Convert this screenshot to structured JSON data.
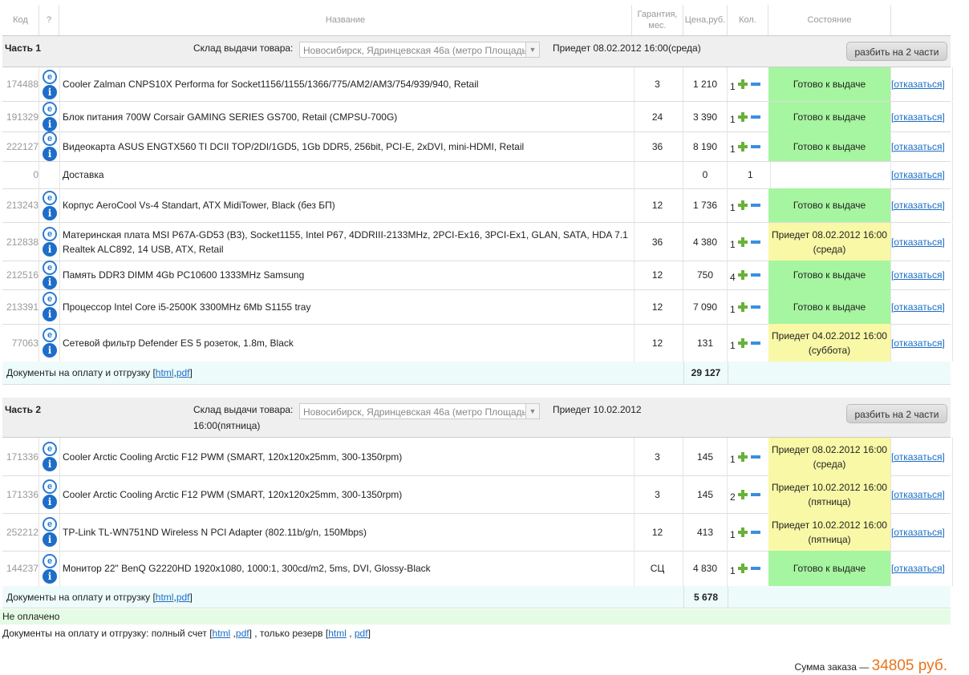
{
  "header": {
    "code": "Код",
    "q": "?",
    "name": "Название",
    "warranty": "Гарантия, мес.",
    "price": "Цена,руб.",
    "qty": "Кол.",
    "state": "Состояние"
  },
  "cancel_label": "[отказаться]",
  "part1": {
    "title": "Часть 1",
    "warehouse_label": "Склад выдачи товара:",
    "warehouse_value": "Новосибирск, Ядринцевская 46а (метро Площадь",
    "arrive": "Приедет 08.02.2012 16:00(среда)",
    "split_label": "разбить на 2 части",
    "rows": [
      {
        "code": "174488",
        "name": "Cooler Zalman CNPS10X Performa for Socket1156/1155/1366/775/AM2/AM3/754/939/940, Retail",
        "warranty": "3",
        "price": "1 210",
        "qty": "1",
        "state": "Готово к выдаче",
        "state_kind": "green"
      },
      {
        "code": "191329",
        "name": "Блок питания 700W Corsair GAMING SERIES GS700, Retail (CMPSU-700G)",
        "warranty": "24",
        "price": "3 390",
        "qty": "1",
        "state": "Готово к выдаче",
        "state_kind": "green"
      },
      {
        "code": "222127",
        "name": "Видеокарта ASUS ENGTX560 TI DCII TOP/2DI/1GD5, 1Gb DDR5, 256bit, PCI-E, 2xDVI, mini-HDMI, Retail",
        "warranty": "36",
        "price": "8 190",
        "qty": "1",
        "state": "Готово к выдаче",
        "state_kind": "green"
      },
      {
        "code": "0",
        "name": "Доставка",
        "warranty": "",
        "price": "0",
        "qty": "1",
        "state": "",
        "state_kind": "none"
      },
      {
        "code": "213243",
        "name": "Корпус AeroCool Vs-4 Standart, ATX MidiTower, Black (без БП)",
        "warranty": "12",
        "price": "1 736",
        "qty": "1",
        "state": "Готово к выдаче",
        "state_kind": "green"
      },
      {
        "code": "212838",
        "name": "Материнская плата MSI P67A-GD53 (B3), Socket1155, Intel P67, 4DDRIII-2133MHz, 2PCI-Ex16, 3PCI-Ex1, GLAN, SATA, HDA 7.1 Realtek ALC892, 14 USB, ATX, Retail",
        "warranty": "36",
        "price": "4 380",
        "qty": "1",
        "state": "Приедет 08.02.2012 16:00 (среда)",
        "state_kind": "yellow"
      },
      {
        "code": "212516",
        "name": "Память DDR3 DIMM 4Gb PC10600 1333MHz Samsung",
        "warranty": "12",
        "price": "750",
        "qty": "4",
        "state": "Готово к выдаче",
        "state_kind": "green"
      },
      {
        "code": "213391",
        "name": "Процессор Intel Core i5-2500K 3300MHz 6Mb S1155 tray",
        "warranty": "12",
        "price": "7 090",
        "qty": "1",
        "state": "Готово к выдаче",
        "state_kind": "green"
      },
      {
        "code": "77063",
        "name": "Сетевой фильтр Defender ES 5 розеток, 1.8m, Black",
        "warranty": "12",
        "price": "131",
        "qty": "1",
        "state": "Приедет 04.02.2012 16:00 (суббота)",
        "state_kind": "yellow"
      }
    ],
    "docs_label": "Документы на оплату и отгрузку [",
    "docs_html": "html",
    "docs_sep": " , ",
    "docs_pdf": "pdf",
    "docs_end": "]",
    "sum": "29 127"
  },
  "part2": {
    "title": "Часть 2",
    "warehouse_label": "Склад выдачи товара:",
    "warehouse_value": "Новосибирск, Ядринцевская 46а (метро Площадь",
    "arrive": "Приедет 10.02.2012",
    "arrive2": "16:00(пятница)",
    "split_label": "разбить на 2 части",
    "rows": [
      {
        "code": "171336",
        "name": "Cooler Arctic Cooling Arctic F12 PWM (SMART, 120x120x25mm, 300-1350rpm)",
        "warranty": "3",
        "price": "145",
        "qty": "1",
        "state": "Приедет 08.02.2012 16:00 (среда)",
        "state_kind": "yellow"
      },
      {
        "code": "171336",
        "name": "Cooler Arctic Cooling Arctic F12 PWM (SMART, 120x120x25mm, 300-1350rpm)",
        "warranty": "3",
        "price": "145",
        "qty": "2",
        "state": "Приедет 10.02.2012 16:00 (пятница)",
        "state_kind": "yellow"
      },
      {
        "code": "252212",
        "name": "TP-Link TL-WN751ND Wireless N PCI Adapter (802.11b/g/n, 150Mbps)",
        "warranty": "12",
        "price": "413",
        "qty": "1",
        "state": "Приедет 10.02.2012 16:00 (пятница)",
        "state_kind": "yellow"
      },
      {
        "code": "144237",
        "name": "Монитор 22\" BenQ G2220HD 1920x1080, 1000:1, 300cd/m2, 5ms, DVI, Glossy-Black",
        "warranty": "СЦ",
        "price": "4 830",
        "qty": "1",
        "state": "Готово к выдаче",
        "state_kind": "green"
      }
    ],
    "docs_label": "Документы на оплату и отгрузку [",
    "docs_html": "html",
    "docs_sep": " , ",
    "docs_pdf": "pdf",
    "docs_end": "]",
    "sum": "5 678"
  },
  "footer": {
    "unpaid": "Не оплачено",
    "docs_label": "Документы на оплату и отгрузку: полный счет [",
    "full_html": "html",
    "full_sep": " ,",
    "full_pdf": "pdf",
    "reserve_label": "] , только резерв [",
    "res_html": "html",
    "res_sep": " , ",
    "res_pdf": "pdf",
    "end": "]",
    "total_label": "Сумма заказа — ",
    "total_value": "34805 руб."
  },
  "colors": {
    "ready": "#a6f5a0",
    "arriving": "#f9f8a6",
    "total": "#e8741c",
    "link": "#1a6ec4"
  },
  "icons": {
    "row_top": "ie-logo-icon",
    "row_bottom": "info-icon",
    "add": "plus-icon",
    "remove": "minus-icon"
  }
}
